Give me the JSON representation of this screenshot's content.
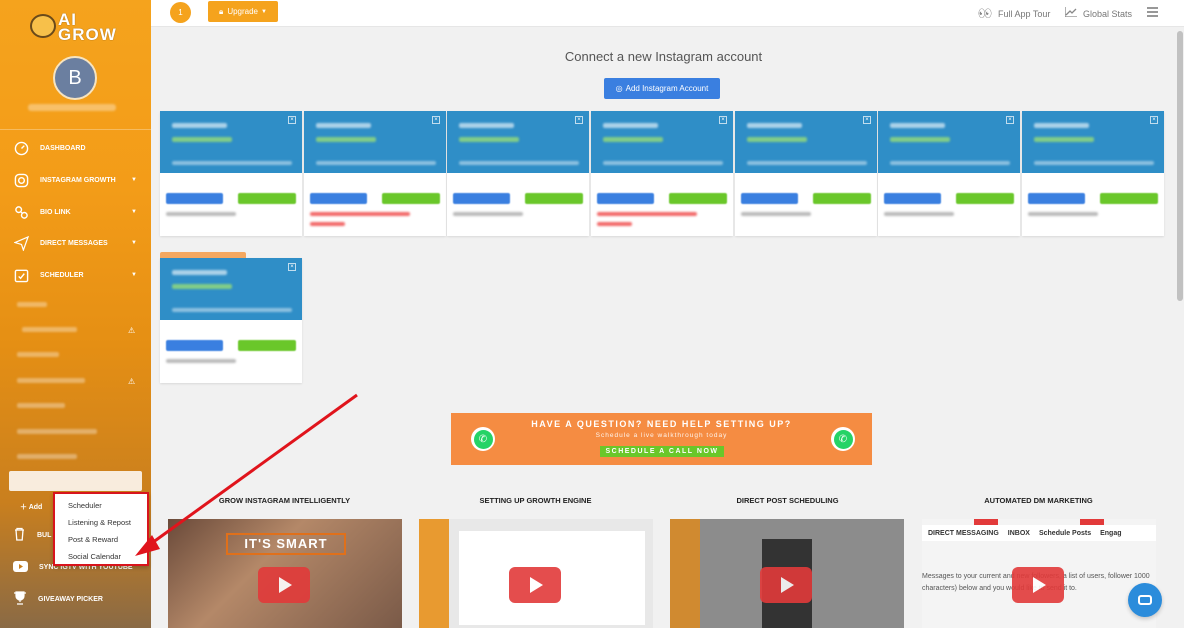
{
  "sidebar": {
    "logo_line1": "AI",
    "logo_line2": "GROW",
    "avatar_letter": "B",
    "items": [
      {
        "label": "DASHBOARD",
        "icon": "dashboard-icon"
      },
      {
        "label": "INSTAGRAM GROWTH",
        "icon": "instagram-icon"
      },
      {
        "label": "BIO LINK",
        "icon": "link-icon"
      },
      {
        "label": "DIRECT MESSAGES",
        "icon": "paper-plane-icon"
      },
      {
        "label": "SCHEDULER",
        "icon": "calendar-check-icon"
      }
    ],
    "add_label": "Add",
    "bottom_items": [
      {
        "label": "BUL",
        "icon": "trash-icon"
      },
      {
        "label": "SYNC IGTV WITH YOUTUBE",
        "icon": "youtube-icon"
      },
      {
        "label": "GIVEAWAY PICKER",
        "icon": "trophy-icon"
      }
    ]
  },
  "popup_menu": {
    "items": [
      "Scheduler",
      "Listening & Repost",
      "Post & Reward",
      "Social Calendar"
    ]
  },
  "topbar": {
    "badge_count": "1",
    "upgrade_label": "Upgrade",
    "tour_label": "Full App Tour",
    "stats_label": "Global Stats"
  },
  "main": {
    "connect_title": "Connect a new Instagram account",
    "add_button_label": "Add Instagram Account",
    "banner": {
      "line1": "HAVE A QUESTION? NEED HELP SETTING UP?",
      "line2": "Schedule a live walkthrough today",
      "cta": "SCHEDULE A CALL NOW"
    },
    "videos": [
      {
        "title": "GROW INSTAGRAM INTELLIGENTLY",
        "overlay": "IT'S SMART"
      },
      {
        "title": "SETTING UP GROWTH ENGINE"
      },
      {
        "title": "DIRECT POST SCHEDULING"
      },
      {
        "title": "AUTOMATED DM MARKETING",
        "tabs": [
          "DIRECT MESSAGING",
          "INBOX",
          "Schedule Posts",
          "Engag"
        ],
        "text": "Messages to your current and new followers, a list of users, follower 1000 characters) below and you would like to send it to."
      }
    ]
  },
  "colors": {
    "brand_orange": "#f5a31d",
    "card_blue": "#2f8ec7",
    "button_blue": "#3a7fe0",
    "green": "#6ac72a",
    "highlight_red": "#d8141c"
  }
}
